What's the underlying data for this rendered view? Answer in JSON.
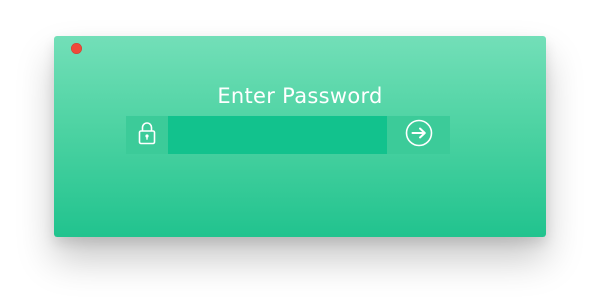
{
  "window": {
    "title": "Enter Password"
  },
  "password_field": {
    "value": "",
    "placeholder": ""
  },
  "icons": {
    "lock": "lock-icon",
    "submit": "arrow-right-circle-icon",
    "close": "close-dot"
  },
  "colors": {
    "window_top": "#73dfb8",
    "window_bottom": "#21c38e",
    "input_bg": "#12c28d",
    "side_box_bg": "#3ccb99",
    "close_button": "#ef4a3a",
    "text": "#ffffff"
  }
}
